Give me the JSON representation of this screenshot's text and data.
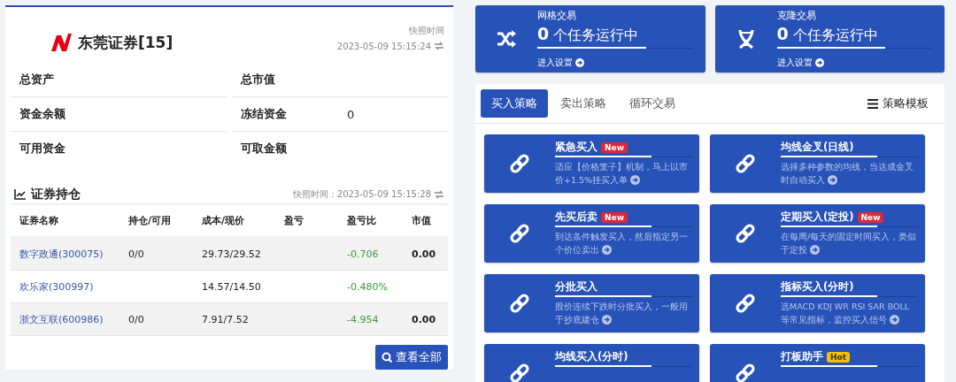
{
  "account": {
    "broker": "东莞证券[15]",
    "snapshot_label": "快照时间",
    "snapshot_time": "2023-05-09 15:15:24",
    "fields": [
      {
        "label": "总资产"
      },
      {
        "label": "总市值"
      },
      {
        "label": "资金余额"
      },
      {
        "label": "冻结资金",
        "value": "0"
      },
      {
        "label": "可用资金"
      },
      {
        "label": "可取金额"
      }
    ]
  },
  "holdings": {
    "title": "证券持仓",
    "snapshot": "快照时间：2023-05-09 15:15:28",
    "columns": [
      "证券名称",
      "持仓/可用",
      "成本/现价",
      "盈亏",
      "盈亏比",
      "市值"
    ],
    "rows": [
      {
        "name": "数字政通(300075)",
        "position": "0/0",
        "cost_price": "29.73/29.52",
        "pl_ratio": "-0.706",
        "market_value": "0.00"
      },
      {
        "name": "欢乐家(300997)",
        "cost_price": "14.57/14.50",
        "pl_ratio": "-0.480%"
      },
      {
        "name": "浙文互联(600986)",
        "position": "0/0",
        "cost_price": "7.91/7.52",
        "pl_ratio": "-4.954",
        "market_value": "0.00"
      }
    ],
    "view_all": "查看全部"
  },
  "tasks": [
    {
      "kind": "shuffle",
      "title": "网格交易",
      "count": "0",
      "status": "个任务运行中",
      "link": "进入设置"
    },
    {
      "kind": "dna",
      "title": "克隆交易",
      "count": "0",
      "status": "个任务运行中",
      "link": "进入设置"
    }
  ],
  "strategy_tabs": [
    {
      "label": "买入策略",
      "selected": true
    },
    {
      "label": "卖出策略",
      "selected": false
    },
    {
      "label": "循环交易",
      "selected": false
    }
  ],
  "template_button": "策略模板",
  "strategies": [
    {
      "title": "紧急买入",
      "badge": {
        "text": "New",
        "kind": "new"
      },
      "description": "适应【价格笼子】机制，马上以市价+1.5%挂买入单"
    },
    {
      "title": "均线金叉(日线)",
      "description": "选择多种参数的均线，当达成金叉时自动买入"
    },
    {
      "title": "先买后卖",
      "badge": {
        "text": "New",
        "kind": "new"
      },
      "description": "到达条件触发买入，然后指定另一个价位卖出"
    },
    {
      "title": "定期买入(定投)",
      "badge": {
        "text": "New",
        "kind": "new"
      },
      "description": "在每周/每天的固定时间买入，类似于定投"
    },
    {
      "title": "分批买入",
      "description": "股价连续下跌时分批买入，一般用于抄底建仓"
    },
    {
      "title": "指标买入(分时)",
      "description": "选MACD KDJ WR RSI SAR BOLL等常见指标，监控买入信号"
    },
    {
      "title": "均线买入(分时)"
    },
    {
      "title": "打板助手",
      "badge": {
        "text": "Hot",
        "kind": "hot"
      }
    }
  ]
}
